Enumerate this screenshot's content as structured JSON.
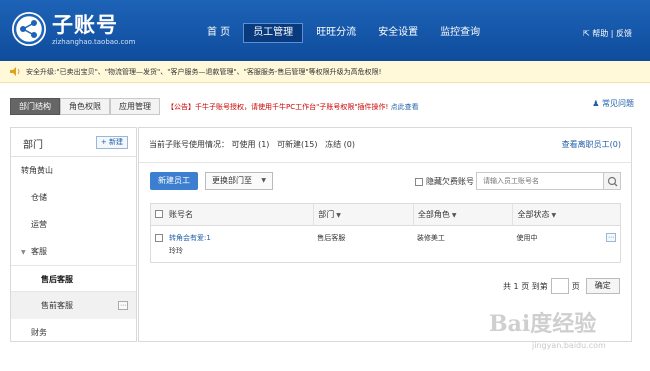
{
  "header": {
    "logo_title": "子账号",
    "logo_sub": "zizhanghao.taobao.com",
    "nav": [
      {
        "label": "首 页"
      },
      {
        "label": "员工管理"
      },
      {
        "label": "旺旺分流"
      },
      {
        "label": "安全设置"
      },
      {
        "label": "监控查询"
      }
    ],
    "help": "帮助",
    "feedback": "反馈"
  },
  "notice": {
    "text": "安全升级:\"已卖出宝贝\"、\"物流管理—发货\"、\"客户服务—退款管理\"、\"客服服务-售后管理\"等权限升级为高危权限!"
  },
  "subtabs": [
    {
      "label": "部门结构"
    },
    {
      "label": "角色权限"
    },
    {
      "label": "应用管理"
    }
  ],
  "announcement": {
    "text": "【公告】千牛子账号授权，请使用千牛PC工作台\"子账号权限\"插件操作!",
    "link": "点此查看"
  },
  "faq": "常见问题",
  "dept": {
    "title": "部门",
    "new_label": "+ 新建",
    "items": [
      {
        "label": "转角黄山"
      },
      {
        "label": "仓储"
      },
      {
        "label": "运营"
      },
      {
        "label": "客服"
      },
      {
        "label": "售后客服"
      },
      {
        "label": "售前客服"
      },
      {
        "label": "财务"
      }
    ]
  },
  "main": {
    "usage_prefix": "当前子账号使用情况：",
    "usage_available": "可使用 (1)",
    "usage_creatable": "可新建(15)",
    "usage_frozen": "冻结 (0)",
    "view_left": "查看离职员工(0)",
    "new_employee": "新建员工",
    "change_dept": "更换部门至",
    "hide_arrears": "隐藏欠费账号",
    "search_placeholder": "请输入员工账号名",
    "columns": [
      "账号名",
      "部门",
      "全部角色",
      "全部状态"
    ],
    "rows": [
      {
        "account": "转角会有爱:1",
        "nickname": "玲玲",
        "dept": "售后客服",
        "role": "装修美工",
        "status": "使用中"
      }
    ],
    "pager": {
      "total_prefix": "共",
      "total_pages": "1",
      "total_suffix": "页 到第",
      "page_suffix": "页",
      "ok": "确定"
    }
  },
  "watermark": {
    "text": "Bai度经验",
    "sub": "jingyan.baidu.com"
  }
}
